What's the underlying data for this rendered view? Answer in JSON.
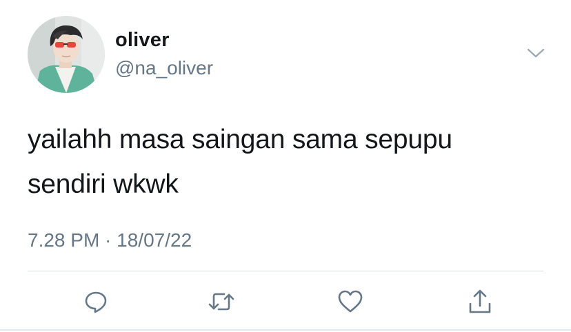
{
  "tweet": {
    "author_name": "oliver",
    "author_handle": "@na_oliver",
    "text_line_1": "yailahh masa saingan sama sepupu",
    "text_line_2": "sendiri wkwk",
    "timestamp": "7.28 PM · 18/07/22"
  },
  "actions": {
    "icons": [
      "reply-icon",
      "retweet-icon",
      "like-icon",
      "share-icon"
    ]
  },
  "colors": {
    "text_primary": "#14171a",
    "text_secondary": "#657786",
    "icon": "#657786",
    "divider": "#d6dde3"
  }
}
